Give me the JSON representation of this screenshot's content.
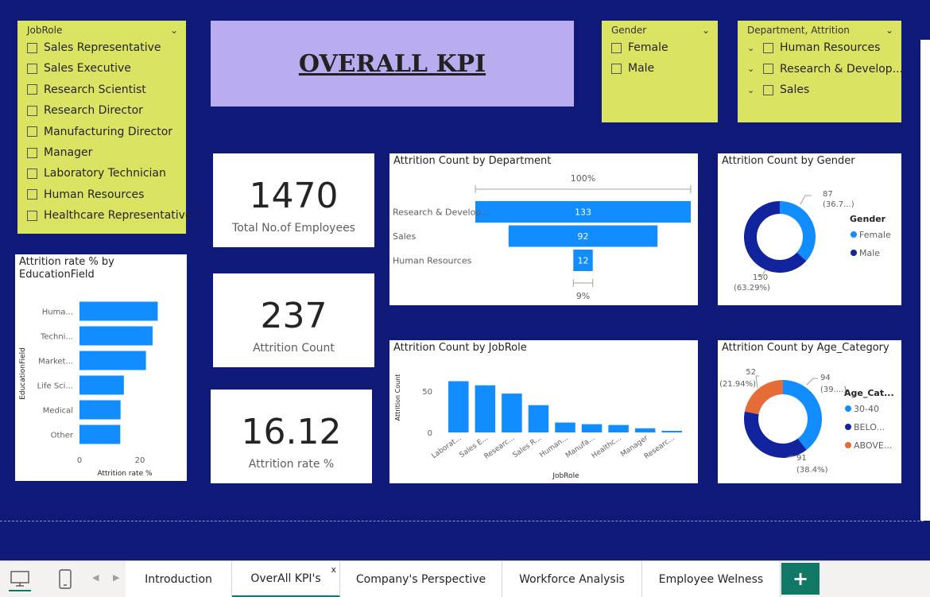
{
  "title": "OVERALL  KPI",
  "slicers": {
    "jobrole": {
      "header": "JobRole",
      "items": [
        "Sales Representative",
        "Sales Executive",
        "Research Scientist",
        "Research Director",
        "Manufacturing Director",
        "Manager",
        "Laboratory Technician",
        "Human Resources",
        "Healthcare Representative"
      ]
    },
    "gender": {
      "header": "Gender",
      "items": [
        "Female",
        "Male"
      ]
    },
    "department": {
      "header": "Department, Attrition",
      "items": [
        "Human Resources",
        "Research & Develop...",
        "Sales"
      ]
    }
  },
  "kpis": {
    "total": {
      "value": "1470",
      "label": "Total No.of Employees"
    },
    "attrition": {
      "value": "237",
      "label": "Attrition Count"
    },
    "rate": {
      "value": "16.12",
      "label": "Attrition rate %"
    }
  },
  "colors": {
    "blue": "#118dff",
    "navy": "#12239e",
    "orange": "#e66c37",
    "canvas": "#0f1a78",
    "slicer": "#dbe462",
    "title_bg": "#b9adef",
    "tab_green": "#117865"
  },
  "chart_data": [
    {
      "id": "education",
      "type": "bar",
      "title": "Attrition rate % by EducationField",
      "categories": [
        "Huma...",
        "Techni...",
        "Market...",
        "Life Sci...",
        "Medical",
        "Other"
      ],
      "values": [
        25.9,
        24.2,
        22.0,
        14.7,
        13.6,
        13.5
      ],
      "xlabel": "Attrition rate %",
      "ylabel": "EducationField",
      "xticks": [
        "0",
        "20"
      ],
      "xlim": [
        0,
        30
      ]
    },
    {
      "id": "department",
      "type": "bar",
      "title": "Attrition Count by Department",
      "categories": [
        "Research & Develop...",
        "Sales",
        "Human Resources"
      ],
      "values": [
        133,
        92,
        12
      ],
      "value_labels": [
        "133",
        "92",
        "12"
      ],
      "top_label": "100%",
      "bottom_label": "9%"
    },
    {
      "id": "gender",
      "type": "pie",
      "title": "Attrition Count by Gender",
      "legend_title": "Gender",
      "labels": [
        "Female",
        "Male"
      ],
      "values": [
        87,
        150
      ],
      "data_labels": [
        [
          "87",
          "(36.7...)"
        ],
        [
          "150",
          "(63.29%)"
        ]
      ],
      "colors": [
        "#118dff",
        "#12239e"
      ]
    },
    {
      "id": "jobrole",
      "type": "bar",
      "title": "Attrition Count by JobRole",
      "categories": [
        "Laborat...",
        "Sales E...",
        "Researc...",
        "Sales R...",
        "Human...",
        "Manufa...",
        "Healthc...",
        "Manager",
        "Researc..."
      ],
      "values": [
        62,
        57,
        47,
        33,
        12,
        10,
        9,
        5,
        2
      ],
      "xlabel": "JobRole",
      "ylabel": "Attrition Count",
      "yticks": [
        "0",
        "50"
      ],
      "ylim": [
        0,
        75
      ]
    },
    {
      "id": "age",
      "type": "pie",
      "title": "Attrition Count by Age_Category",
      "legend_title": "Age_Cat...",
      "labels": [
        "30-40",
        "BELO...",
        "ABOVE..."
      ],
      "values": [
        94,
        91,
        52
      ],
      "data_labels": [
        [
          "94",
          "(39....)"
        ],
        [
          "91",
          "(38.4%)"
        ],
        [
          "52",
          "(21.94%)"
        ]
      ],
      "colors": [
        "#118dff",
        "#12239e",
        "#e66c37"
      ]
    }
  ],
  "tabs": {
    "items": [
      "Introduction",
      "OverAll KPI's",
      "Company's Perspective",
      "Workforce Analysis",
      "Employee Welness"
    ],
    "close": "x",
    "add": "+"
  }
}
